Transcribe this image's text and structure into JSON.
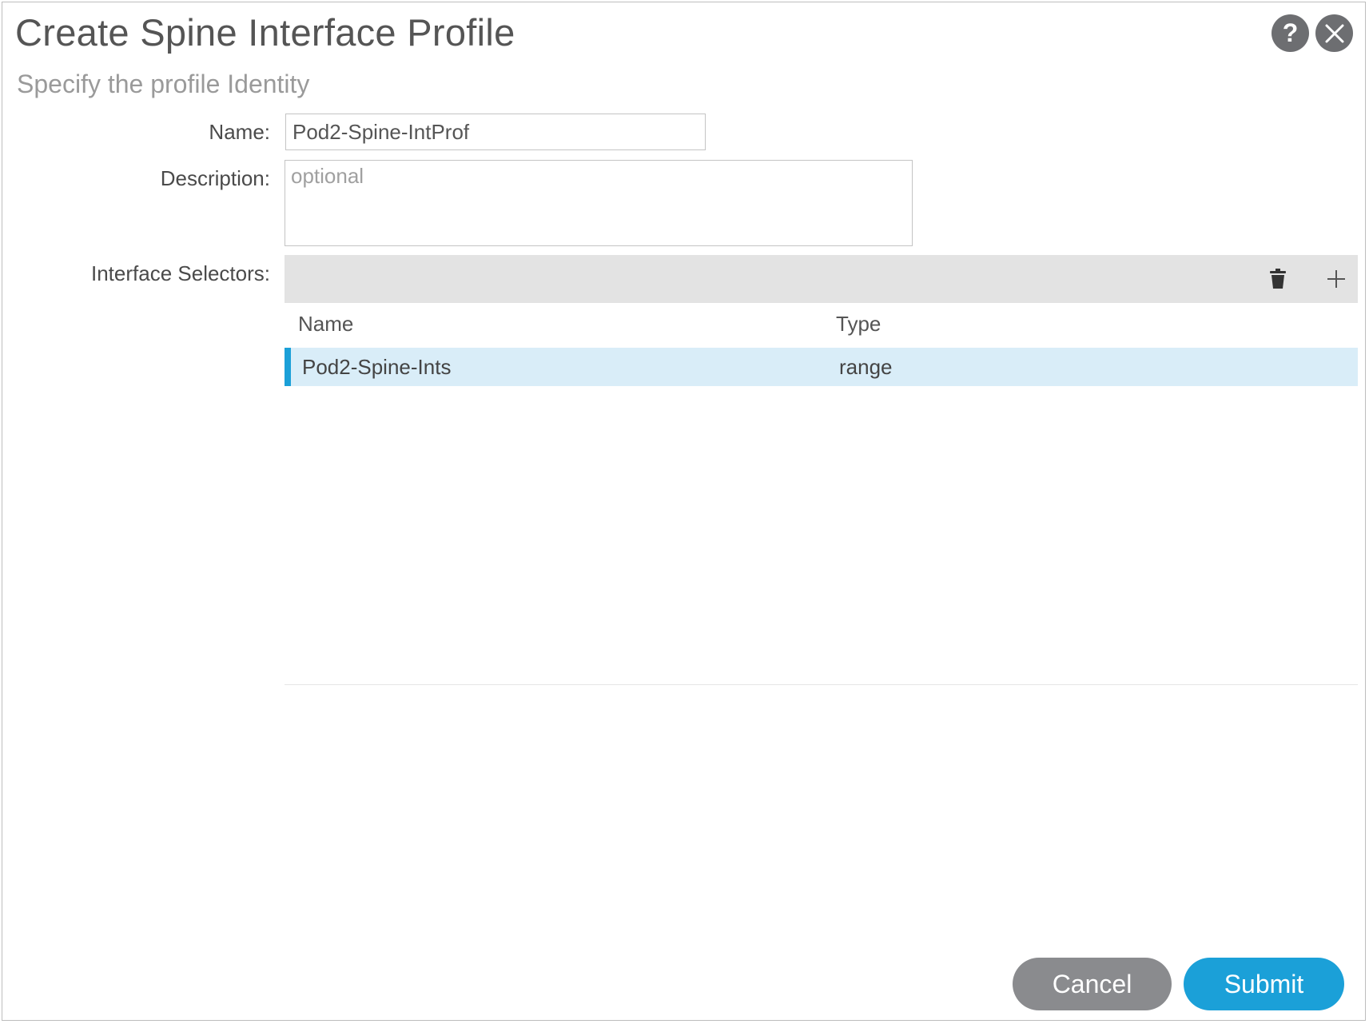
{
  "dialog": {
    "title": "Create Spine Interface Profile",
    "subtitle": "Specify the profile Identity",
    "help_icon": "question-mark-icon",
    "close_icon": "close-icon"
  },
  "form": {
    "name_label": "Name:",
    "name_value": "Pod2-Spine-IntProf",
    "description_label": "Description:",
    "description_value": "",
    "description_placeholder": "optional",
    "selectors_label": "Interface Selectors:"
  },
  "toolbar": {
    "delete_icon": "trash-icon",
    "add_icon": "plus-icon"
  },
  "table": {
    "columns": [
      "Name",
      "Type"
    ],
    "rows": [
      {
        "name": "Pod2-Spine-Ints",
        "type": "range",
        "selected": true
      }
    ]
  },
  "footer": {
    "cancel_label": "Cancel",
    "submit_label": "Submit"
  },
  "colors": {
    "accent": "#1ba0d8",
    "selected_row": "#d9edf8",
    "toolbar_bg": "#e3e3e3",
    "cancel_bg": "#8a8b8e",
    "header_icon_bg": "#6d6e71"
  }
}
